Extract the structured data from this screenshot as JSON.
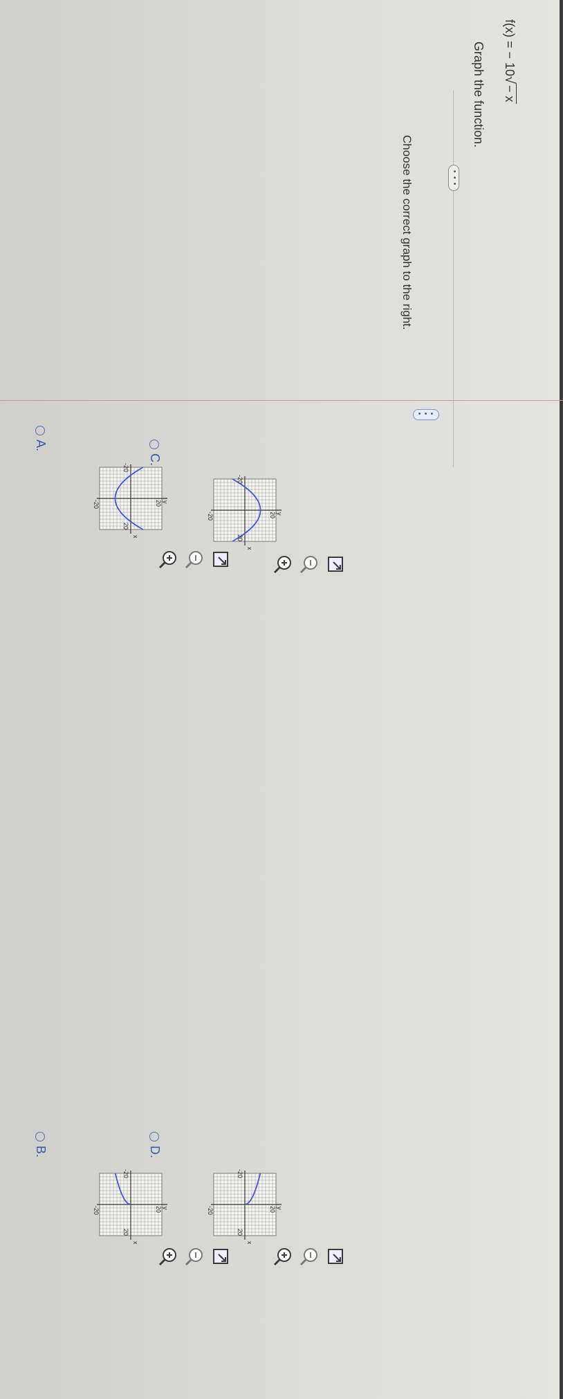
{
  "question": {
    "title": "Graph the function.",
    "function_prefix": "f(x) = − 10",
    "function_radicand": "− x",
    "instruction": "Choose the correct graph to the right.",
    "more_label": "• • •"
  },
  "options": [
    {
      "letter": "A.",
      "curve": "parabola-up",
      "axis_label_x": "x",
      "axis_label_y": "y",
      "tick_pos": "20",
      "tick_neg": "-20"
    },
    {
      "letter": "B.",
      "curve": "sqrt-down-left",
      "axis_label_x": "x",
      "axis_label_y": "y",
      "tick_pos": "20",
      "tick_neg": "-20"
    },
    {
      "letter": "C.",
      "curve": "parabola-down",
      "axis_label_x": "x",
      "axis_label_y": "y",
      "tick_pos": "20",
      "tick_neg": "-20"
    },
    {
      "letter": "D.",
      "curve": "sqrt-up-left",
      "axis_label_x": "x",
      "axis_label_y": "y",
      "tick_pos": "20",
      "tick_neg": "-20"
    }
  ],
  "colors": {
    "option_blue": "#3a5aa6",
    "curve_blue": "#4a57c9",
    "grid": "#9a9a9a"
  },
  "icons": [
    "zoom-in-icon",
    "zoom-out-icon",
    "popout-icon"
  ]
}
